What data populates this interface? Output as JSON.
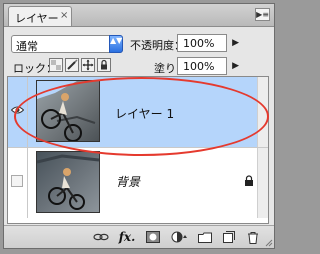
{
  "panel": {
    "tab_label": "レイヤー",
    "tab_close": "×",
    "menu_glyph": "▶≡"
  },
  "blend": {
    "mode_value": "通常",
    "arrow_glyph": "▲▼"
  },
  "opacity": {
    "label": "不透明度：",
    "value": "100%",
    "arrow_glyph": "▶"
  },
  "lock": {
    "label": "ロック：",
    "icons": [
      "lock-transparent-icon",
      "lock-image-icon",
      "lock-position-icon",
      "lock-all-icon"
    ]
  },
  "fill": {
    "label": "塗り：",
    "value": "100%",
    "arrow_glyph": "▶"
  },
  "layers": [
    {
      "name": "レイヤー 1",
      "visible": true,
      "selected": true,
      "locked": false
    },
    {
      "name": "背景",
      "visible": false,
      "selected": false,
      "locked": true
    }
  ],
  "bottom_bar": {
    "fx_label": "fx.",
    "icons": [
      "link-icon",
      "fx-icon",
      "mask-icon",
      "adjustment-icon",
      "folder-icon",
      "new-layer-icon",
      "trash-icon"
    ]
  },
  "colors": {
    "selection": "#b5d5fb",
    "annotation": "#e53a2e",
    "accent": "#2a70e0"
  }
}
